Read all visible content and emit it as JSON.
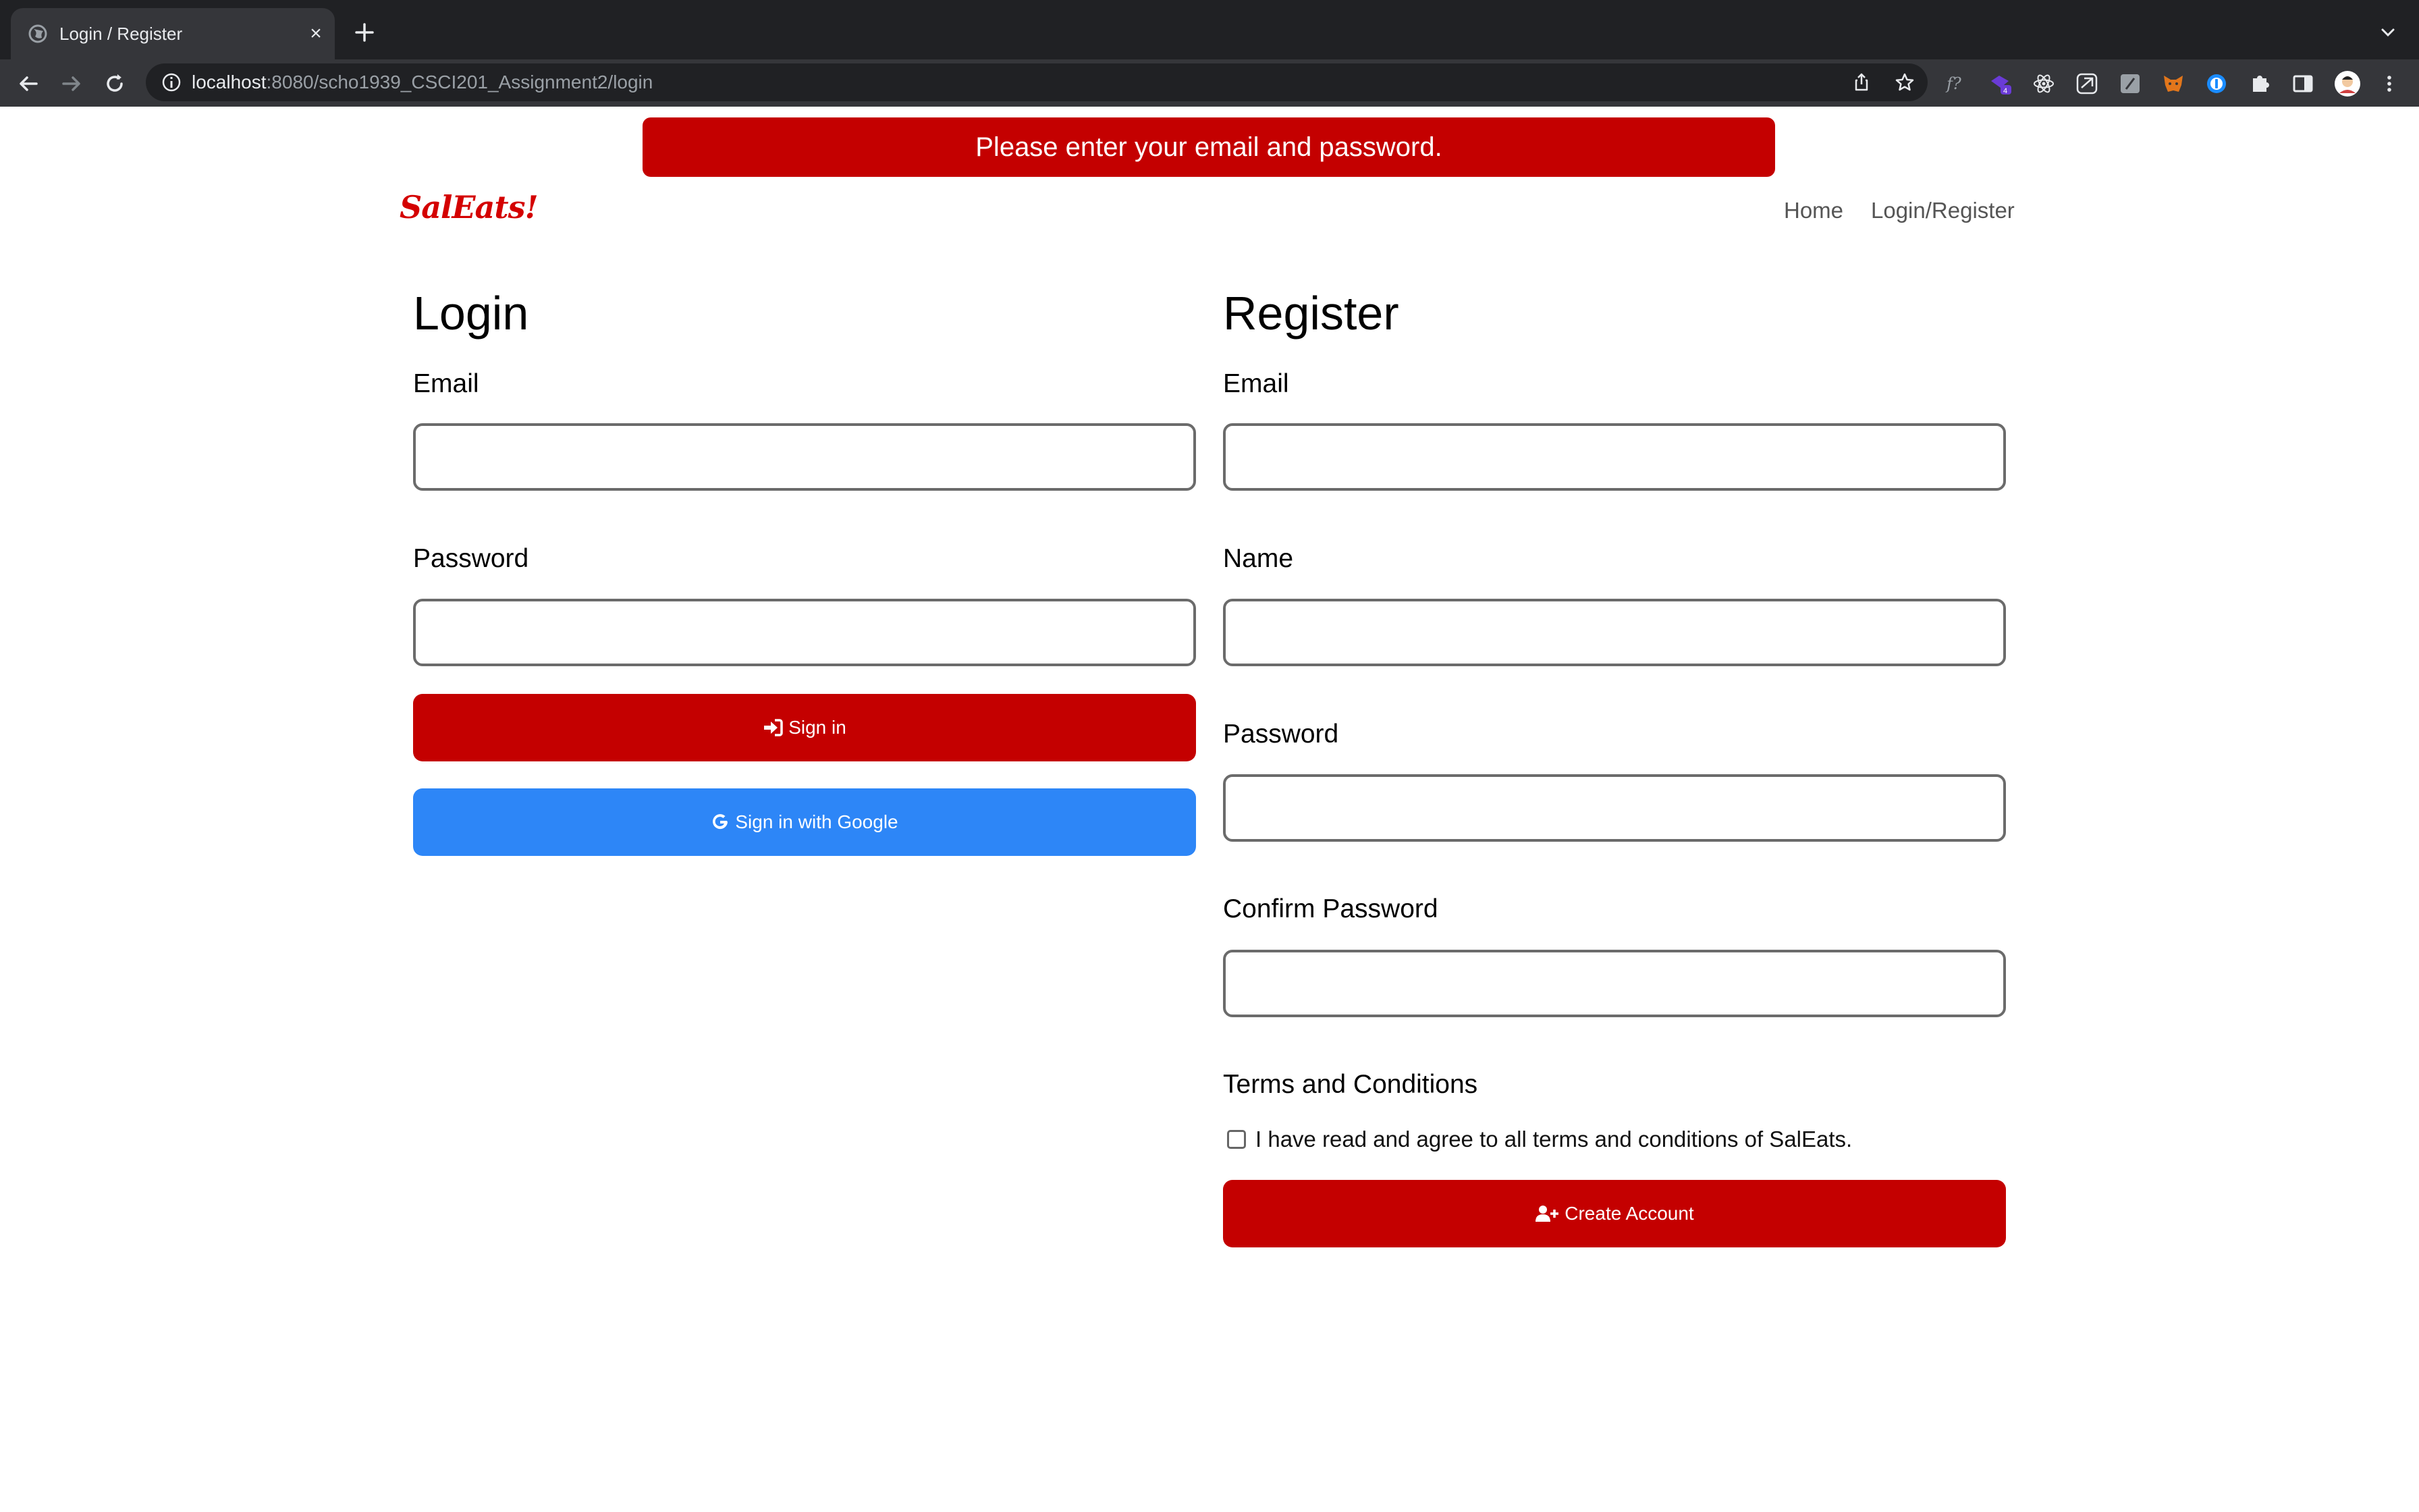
{
  "browser": {
    "tab_title": "Login / Register",
    "url_host": "localhost",
    "url_path": ":8080/scho1939_CSCI201_Assignment2/login",
    "extension_badge": "4"
  },
  "alert": {
    "message": "Please enter your email and password."
  },
  "navbar": {
    "brand": "SalEats!",
    "links": [
      "Home",
      "Login/Register"
    ]
  },
  "login": {
    "title": "Login",
    "email_label": "Email",
    "email_value": "",
    "password_label": "Password",
    "password_value": "",
    "signin_label": "Sign in",
    "google_label": "Sign in with Google"
  },
  "register": {
    "title": "Register",
    "email_label": "Email",
    "email_value": "",
    "name_label": "Name",
    "name_value": "",
    "password_label": "Password",
    "password_value": "",
    "confirm_label": "Confirm Password",
    "confirm_value": "",
    "terms_title": "Terms and Conditions",
    "terms_checked": false,
    "terms_text": "I have read and agree to all terms and conditions of SalEats.",
    "create_label": "Create Account"
  },
  "colors": {
    "brand_red": "#c40000",
    "google_blue": "#2d86f7",
    "chrome_dark": "#202124"
  }
}
